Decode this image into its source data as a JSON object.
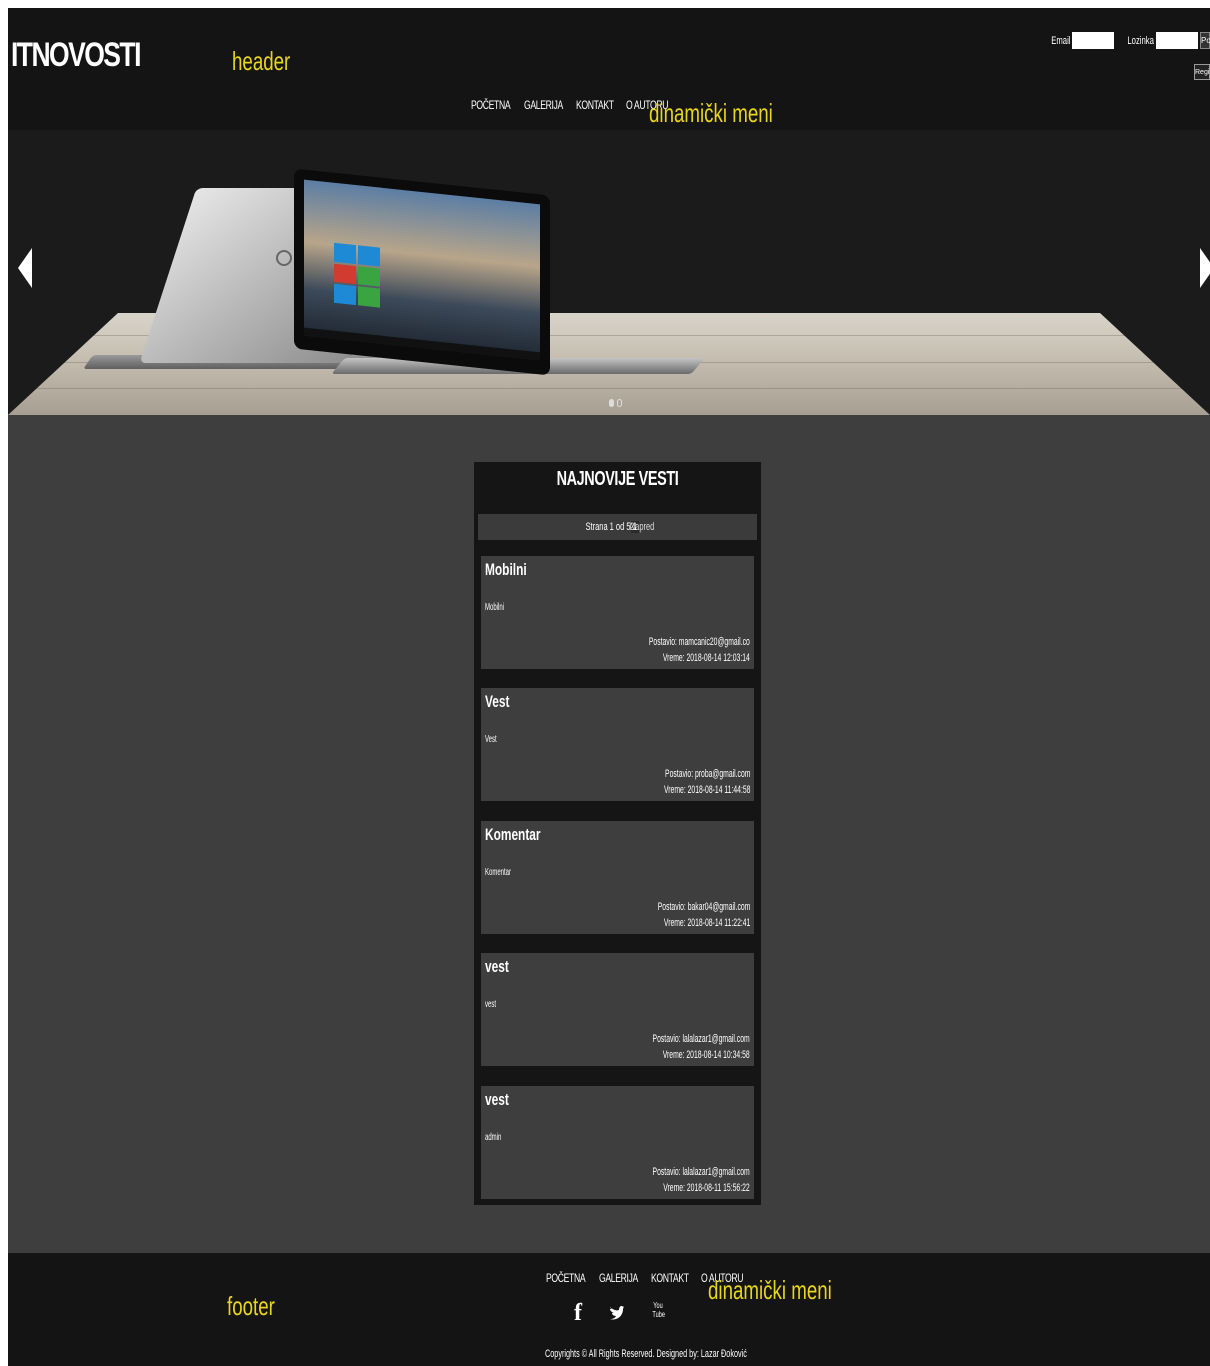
{
  "header": {
    "logo": "ITNOVOSTI",
    "annotation": "header",
    "menu_annotation": "dinamički meni",
    "nav": [
      "POČETNA",
      "GALERIJA",
      "KONTAKT",
      "O AUTORU"
    ],
    "login": {
      "email_label": "Email",
      "password_label": "Lozinka",
      "submit_label": "Po",
      "register_label": "Regist"
    }
  },
  "slider": {
    "slides_count": 2,
    "active_slide": 1
  },
  "news": {
    "title": "NAJNOVIJE VESTI",
    "pagination": {
      "text": "Strana 1 od 5",
      "current": "1",
      "next_page": "2",
      "next_label": "Napred"
    },
    "items": [
      {
        "title": "Mobilni",
        "body": "Mobilni",
        "author": "Postavio: mamcanic20@gmail.co",
        "time": "Vreme: 2018-08-14 12:03:14"
      },
      {
        "title": "Vest",
        "body": "Vest",
        "author": "Postavio: proba@gmail.com",
        "time": "Vreme: 2018-08-14 11:44:58"
      },
      {
        "title": "Komentar",
        "body": "Komentar",
        "author": "Postavio: bakar04@gmail.com",
        "time": "Vreme: 2018-08-14 11:22:41"
      },
      {
        "title": "vest",
        "body": "vest",
        "author": "Postavio: lalalazar1@gmail.com",
        "time": "Vreme: 2018-08-14 10:34:58"
      },
      {
        "title": "vest",
        "body": "admin",
        "author": "Postavio: lalalazar1@gmail.com",
        "time": "Vreme: 2018-08-11 15:56:22"
      }
    ]
  },
  "footer": {
    "annotation": "footer",
    "menu_annotation": "dinamički meni",
    "nav": [
      "POČETNA",
      "GALERIJA",
      "KONTAKT",
      "O AUTORU"
    ],
    "social": [
      "facebook-icon",
      "twitter-icon",
      "youtube-icon"
    ],
    "social_fb_glyph": "f",
    "social_yt_text": "You Tube",
    "copyright": "Copyrights © All Rights Reserved. Designed by: Lazar Đoković"
  }
}
